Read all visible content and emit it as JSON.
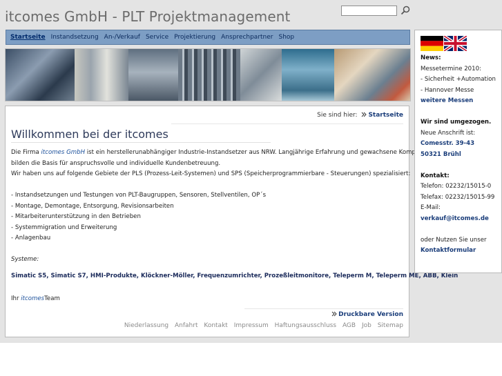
{
  "header": {
    "site_title": "itcomes GmbH - PLT Projektmanagement",
    "search_placeholder": ""
  },
  "nav": {
    "items": [
      {
        "label": "Startseite",
        "active": true
      },
      {
        "label": "Instandsetzung"
      },
      {
        "label": "An-/Verkauf"
      },
      {
        "label": "Service"
      },
      {
        "label": "Projektierung"
      },
      {
        "label": "Ansprechpartner"
      },
      {
        "label": "Shop"
      }
    ]
  },
  "breadcrumb": {
    "prefix": "Sie sind hier:",
    "current": "Startseite"
  },
  "main": {
    "heading": "Willkommen bei der itcomes",
    "intro_1": "Die Firma",
    "intro_brand": "itcomes GmbH",
    "intro_2": "ist ein herstellerunabhängiger Industrie-Instandsetzer aus NRW. Langjährige Erfahrung und gewachsene Kompetenz",
    "intro_3": "bilden die Basis für anspruchsvolle und individuelle Kundenbetreuung.",
    "intro_4": "Wir haben uns auf folgende Gebiete der PLS (Prozess-Leit-Systemen) und SPS (Speicherprogrammierbare - Steuerungen) spezialisiert:",
    "list": [
      "- Instandsetzungen und Testungen von PLT-Baugruppen, Sensoren, Stellventilen, OP´s",
      "- Montage, Demontage, Entsorgung, Revisionsarbeiten",
      "- Mitarbeiterunterstützung in den Betrieben",
      "- Systemmigration und Erweiterung",
      "- Anlagenbau"
    ],
    "systems_label": "Systeme:",
    "systems": "Simatic S5, Simatic S7, HMI-Produkte, Klöckner-Möller, Frequenzumrichter, Prozeßleitmonitore, Teleperm M, Teleperm ME, ABB, Klein",
    "signoff_1": "Ihr",
    "signoff_brand": "itcomes",
    "signoff_2": "Team",
    "print_label": "Druckbare Version"
  },
  "footer": {
    "links": [
      "Niederlassung",
      "Anfahrt",
      "Kontakt",
      "Impressum",
      "Haftungsausschluss",
      "AGB",
      "Job",
      "Sitemap"
    ]
  },
  "sidebar": {
    "news_title": "News:",
    "news_line1": "Messetermine 2010:",
    "news_line2": "- Sicherheit +Automation",
    "news_line3": "- Hannover Messe",
    "news_link": "weitere Messen",
    "moved_title": "Wir sind umgezogen.",
    "moved_line1": "Neue Anschrift ist:",
    "moved_street": "Comesstr. 39-43",
    "moved_city": "50321 Brühl",
    "contact_title": "Kontakt:",
    "phone": "Telefon: 02232/15015-0",
    "fax": "Telefax: 02232/15015-99",
    "email_label": "E-Mail:",
    "email": "verkauf@itcomes.de",
    "form_line": "oder Nutzen Sie unser",
    "form_link": "Kontaktformular"
  },
  "colors": {
    "nav_bg": "#7d9ec4",
    "link": "#1a3d7a",
    "page_bg": "#e4e4e4"
  }
}
